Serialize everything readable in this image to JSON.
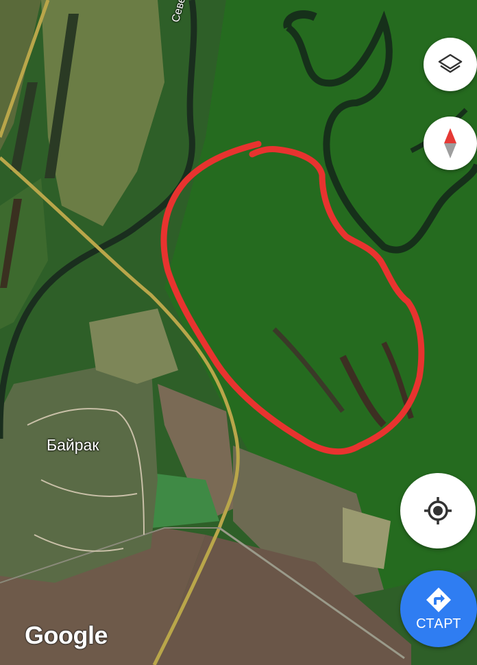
{
  "map": {
    "place_label": "Байрак",
    "road_label": "Северс",
    "provider_logo": "Google",
    "annotation_color": "#e8332f"
  },
  "controls": {
    "layers_icon": "layers-icon",
    "compass_icon": "compass-icon",
    "locate_icon": "my-location-icon",
    "directions_icon": "directions-arrow-icon",
    "start_label": "СТАРТ",
    "start_color": "#2f7df2"
  }
}
